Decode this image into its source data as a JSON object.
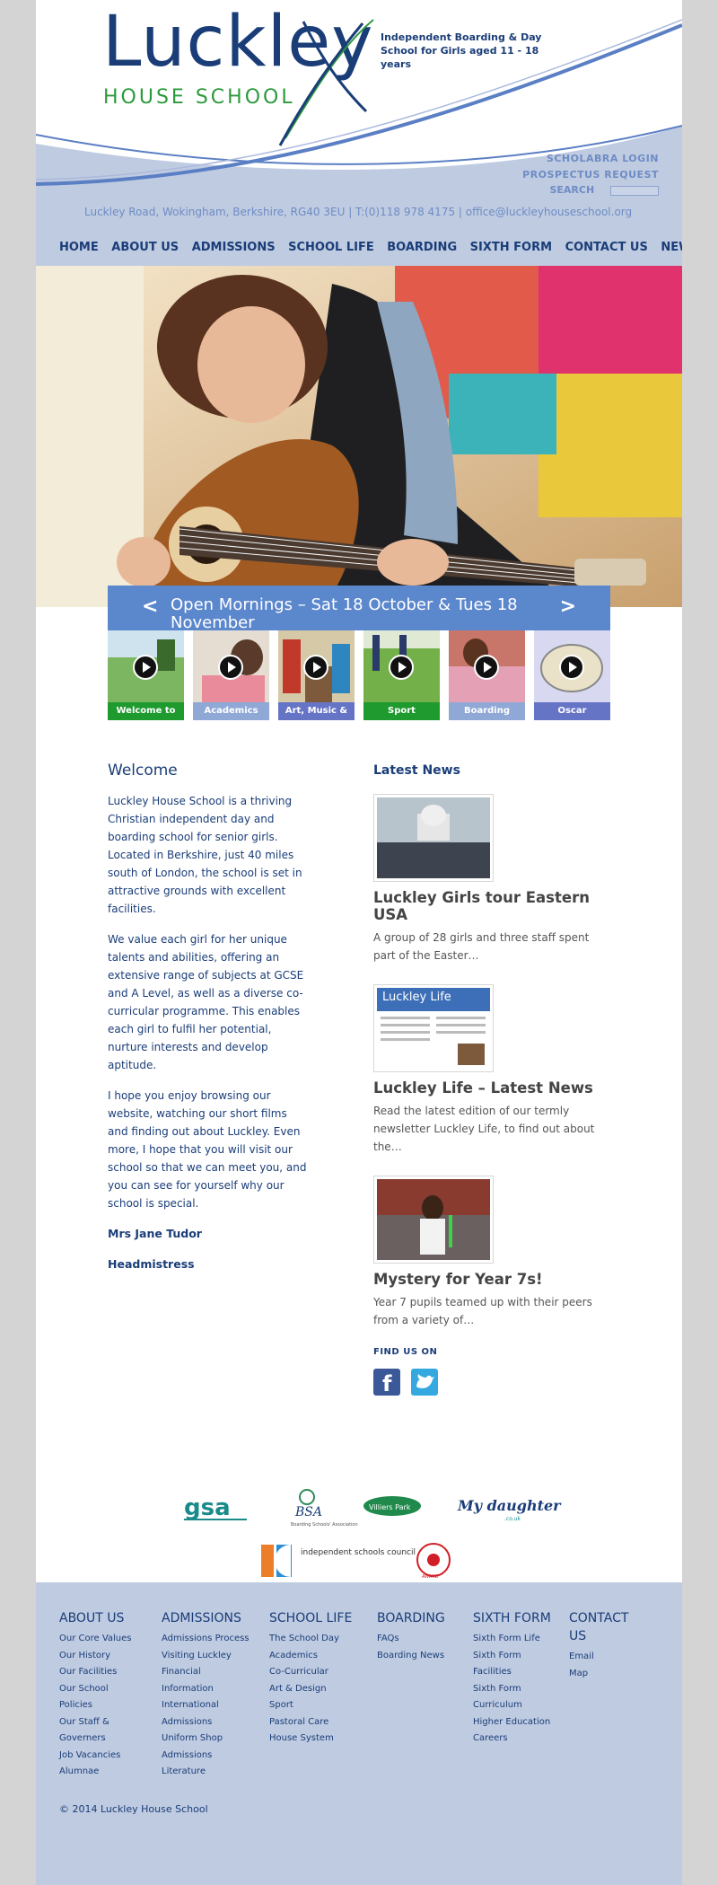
{
  "header": {
    "logo_title": "Luckley",
    "logo_subtitle": "HOUSE SCHOOL",
    "tagline": "Independent Boarding & Day School for Girls aged 11 - 18 years",
    "links": [
      "SCHOLABRA LOGIN",
      "PROSPECTUS REQUEST"
    ],
    "search_label": "SEARCH",
    "search_placeholder": "",
    "address": "Luckley Road, Wokingham, Berkshire, RG40 3EU  |  T:(0)118 978 4175  |  office@luckleyhouseschool.org"
  },
  "nav": [
    "HOME",
    "ABOUT US",
    "ADMISSIONS",
    "SCHOOL LIFE",
    "BOARDING",
    "SIXTH FORM",
    "CONTACT US",
    "NEWS"
  ],
  "banner": {
    "prev": "<",
    "next": ">",
    "text": "Open Mornings – Sat 18 October & Tues 18 November"
  },
  "videos": [
    {
      "label": "Welcome to",
      "color": "#1f9a2f"
    },
    {
      "label": "Academics",
      "color": "#8fa8d6"
    },
    {
      "label": "Art, Music &",
      "color": "#6674c6"
    },
    {
      "label": "Sport",
      "color": "#1f9a2f"
    },
    {
      "label": "Boarding",
      "color": "#8fa8d6"
    },
    {
      "label": "Oscar",
      "color": "#6674c6"
    }
  ],
  "welcome": {
    "title": "Welcome",
    "paragraphs": [
      "Luckley House School is a thriving Christian independent day and boarding school for senior girls. Located in Berkshire, just 40 miles south of London, the school is set in attractive grounds with excellent facilities.",
      "We value each girl for her unique talents and abilities, offering an extensive range of subjects at GCSE and A Level, as well as a diverse co-curricular programme. This enables each girl to fulfil her potential, nurture interests and develop aptitude.",
      "I hope you enjoy browsing our website, watching our short films and finding out about Luckley. Even more, I hope that you will visit our school so that we can meet you, and you can see for yourself why our school is special."
    ],
    "signature_name": "Mrs Jane Tudor",
    "signature_role": "Headmistress"
  },
  "news": {
    "heading": "Latest News",
    "items": [
      {
        "title": "Luckley Girls tour Eastern USA",
        "summary": "A group of 28 girls and three staff spent part of the Easter…"
      },
      {
        "title": "Luckley Life – Latest News",
        "summary": "Read the latest edition of our termly newsletter Luckley Life, to find out about the…",
        "thumb_text": "Luckley Life"
      },
      {
        "title": "Mystery for Year 7s!",
        "summary": "Year 7 pupils teamed up with their peers from a variety of…"
      }
    ]
  },
  "find_us": "FIND US ON",
  "accreditations": {
    "gsa": "gsa",
    "bsa": "BSA",
    "bsa_sub": "Boarding Schools' Association",
    "villiers": "Villiers Park",
    "mydaughter": "My daughter",
    "mydaughter_sub": ".co.uk",
    "isc": "independent schools council",
    "award": "AWARD"
  },
  "footer": {
    "columns": [
      {
        "heading": "ABOUT US",
        "links": [
          "Our Core Values",
          "Our History",
          "Our Facilities",
          "Our School",
          "Policies",
          "Our Staff &",
          "Governers",
          "Job Vacancies",
          "Alumnae"
        ]
      },
      {
        "heading": "ADMISSIONS",
        "links": [
          "Admissions Process",
          "Visiting Luckley",
          "Financial",
          "Information",
          "International",
          "Admissions",
          "Uniform Shop",
          "Admissions",
          "Literature"
        ]
      },
      {
        "heading": "SCHOOL LIFE",
        "links": [
          "The School Day",
          "Academics",
          "Co-Curricular",
          "Art & Design",
          "Sport",
          "Pastoral Care",
          "House System"
        ]
      },
      {
        "heading": "BOARDING",
        "links": [
          "FAQs",
          "Boarding News"
        ]
      },
      {
        "heading": "SIXTH FORM",
        "links": [
          "Sixth Form Life",
          "Sixth Form",
          "Facilities",
          "Sixth Form",
          "Curriculum",
          "Higher Education",
          "Careers"
        ]
      },
      {
        "heading": "CONTACT US",
        "links": [
          "Email",
          "Map"
        ]
      }
    ],
    "copyright": "© 2014 Luckley House School"
  },
  "colors": {
    "navy": "#1a3d78",
    "green": "#2c9a3c",
    "light_blue_bg": "#bfcbe1",
    "banner_blue": "#5b87cd"
  }
}
